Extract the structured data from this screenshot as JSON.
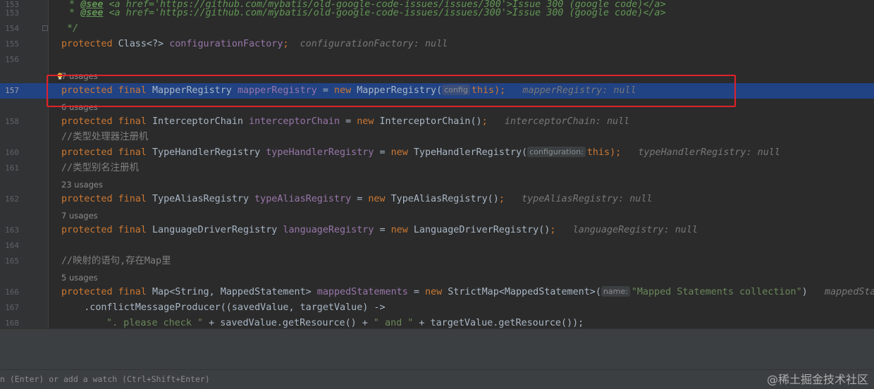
{
  "editor": {
    "lines": {
      "l153": {
        "num": "153",
        "prefix": " * ",
        "tag": "@see",
        "text": " <a href='https://github.com/mybatis/old-google-code-issues/issues/300'>Issue 300 (google code)</a>"
      },
      "l154": {
        "num": "154",
        "text": " */"
      },
      "l155": {
        "num": "155",
        "kw": "protected",
        "type": " Class<?> ",
        "field": "configurationFactory",
        "end": ";",
        "dbg": "configurationFactory: null"
      },
      "l156": {
        "num": "156"
      },
      "l157": {
        "num": "157",
        "kw": "protected final",
        "type": " MapperRegistry ",
        "field": "mapperRegistry",
        "op": " = ",
        "new": "new",
        "ctor": " MapperRegistry(",
        "hint": "config",
        "this": "this",
        "end": ");",
        "dbg": "mapperRegistry: null"
      },
      "l158": {
        "num": "158",
        "kw": "protected final",
        "type": " InterceptorChain ",
        "field": "interceptorChain",
        "op": " = ",
        "new": "new",
        "ctor": " InterceptorChain()",
        "end": ";",
        "dbg": "interceptorChain: null"
      },
      "l159": {
        "comment": "//类型处理器注册机"
      },
      "l160": {
        "num": "160",
        "kw": "protected final",
        "type": " TypeHandlerRegistry ",
        "field": "typeHandlerRegistry",
        "op": " = ",
        "new": "new",
        "ctor": " TypeHandlerRegistry(",
        "hint": "configuration:",
        "this": "this",
        "end": ");",
        "dbg": "typeHandlerRegistry: null"
      },
      "l161": {
        "num": "161",
        "comment": "//类型别名注册机"
      },
      "l162": {
        "num": "162",
        "kw": "protected final",
        "type": " TypeAliasRegistry ",
        "field": "typeAliasRegistry",
        "op": " = ",
        "new": "new",
        "ctor": " TypeAliasRegistry()",
        "end": ";",
        "dbg": "typeAliasRegistry: null"
      },
      "l163": {
        "num": "163",
        "kw": "protected final",
        "type": " LanguageDriverRegistry ",
        "field": "languageRegistry",
        "op": " = ",
        "new": "new",
        "ctor": " LanguageDriverRegistry()",
        "end": ";",
        "dbg": "languageRegistry: null"
      },
      "l164": {
        "num": "164"
      },
      "l165": {
        "num": "165",
        "comment": "//映射的语句,存在Map里"
      },
      "l166": {
        "num": "166",
        "kw": "protected final",
        "type": " Map<String, MappedStatement> ",
        "field": "mappedStatements",
        "op": " = ",
        "new": "new",
        "ctor": " StrictMap<MappedStatement>(",
        "hint": "name:",
        "str": "\"Mapped Statements collection\"",
        "end": ")",
        "dbg": "mappedStat"
      },
      "l167": {
        "num": "167",
        "text": "    .conflictMessageProducer((savedValue, targetValue) ->"
      },
      "l168": {
        "num": "168",
        "str1": "\". please check \"",
        "mid1": " + savedValue.getResource() + ",
        "str2": "\" and \"",
        "mid2": " + targetValue.getResource());"
      }
    },
    "usages": {
      "u157": "7 usages",
      "u158": "6 usages",
      "u162": "23 usages",
      "u163": "7 usages",
      "u166": "5 usages"
    }
  },
  "debug_panel": {
    "watch_hint": "n (Enter) or add a watch (Ctrl+Shift+Enter)",
    "watermark": "@稀土掘金技术社区"
  }
}
